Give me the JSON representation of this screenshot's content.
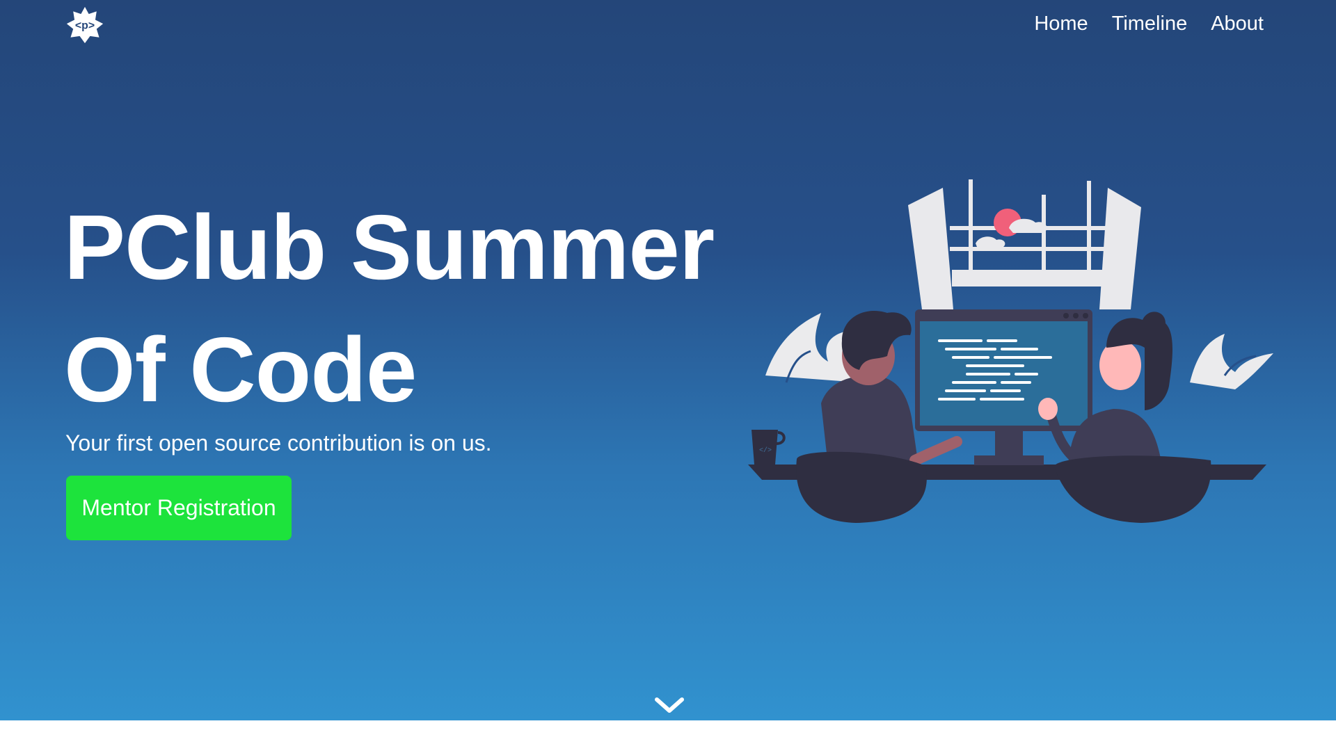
{
  "nav": {
    "logo_icon": "code-tag-logo-icon",
    "logo_text": "<p>",
    "links": [
      {
        "label": "Home"
      },
      {
        "label": "Timeline"
      },
      {
        "label": "About"
      }
    ]
  },
  "hero": {
    "title": "PClub Summer Of Code",
    "subtitle": "Your first open source contribution is on us.",
    "cta_label": "Mentor Registration",
    "cta_color": "#1de33c",
    "mug_text": "</>",
    "illustration": "two-people-coding-at-computer-illustration",
    "scroll_icon": "chevron-down-icon"
  },
  "colors": {
    "gradient_top": "#244679",
    "gradient_bottom": "#3192cf",
    "text": "#ffffff"
  }
}
